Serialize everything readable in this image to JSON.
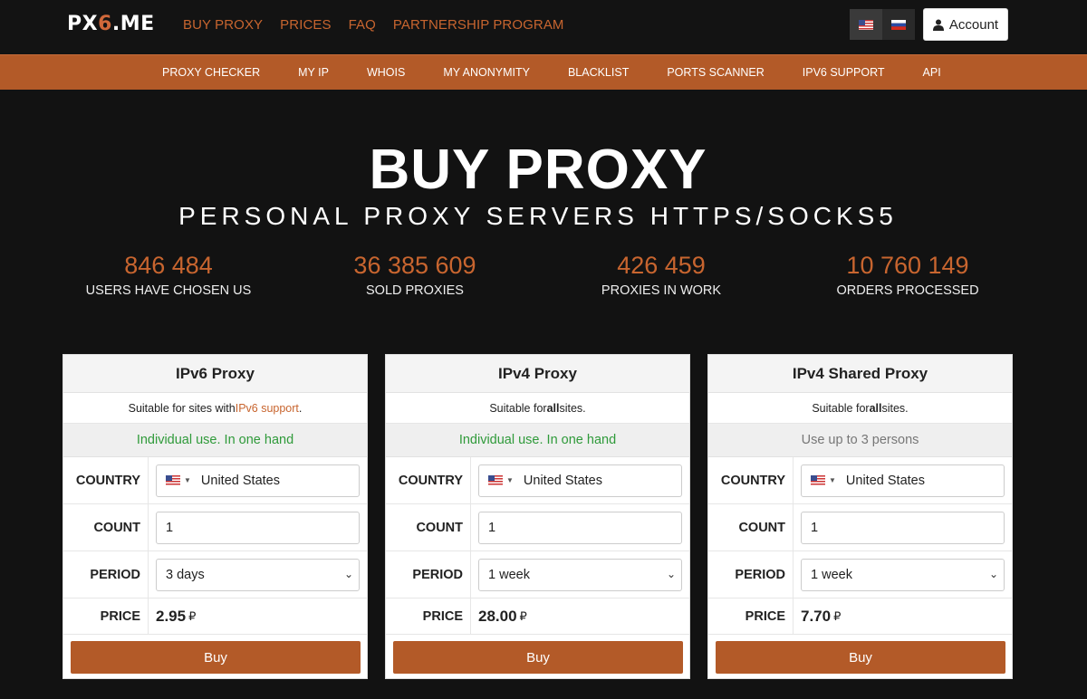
{
  "logo": {
    "prefix": "PX",
    "six": "6",
    "suffix": ".ME"
  },
  "main_nav": [
    "BUY PROXY",
    "PRICES",
    "FAQ",
    "PARTNERSHIP PROGRAM"
  ],
  "account_label": "Account",
  "sub_nav": [
    "PROXY CHECKER",
    "MY IP",
    "WHOIS",
    "MY ANONYMITY",
    "BLACKLIST",
    "PORTS SCANNER",
    "IPV6 SUPPORT",
    "API"
  ],
  "hero": {
    "title": "BUY PROXY",
    "subtitle": "PERSONAL PROXY SERVERS HTTPS/SOCKS5"
  },
  "stats": [
    {
      "num": "846 484",
      "label": "USERS HAVE CHOSEN US"
    },
    {
      "num": "36 385 609",
      "label": "SOLD PROXIES"
    },
    {
      "num": "426 459",
      "label": "PROXIES IN WORK"
    },
    {
      "num": "10 760 149",
      "label": "ORDERS PROCESSED"
    }
  ],
  "labels": {
    "country": "COUNTRY",
    "count": "COUNT",
    "period": "PERIOD",
    "price": "PRICE",
    "currency": "₽",
    "buy": "Buy"
  },
  "cards": [
    {
      "title": "IPv6 Proxy",
      "suit_pre": "Suitable for sites with ",
      "suit_hl": "IPv6 support",
      "suit_post": ".",
      "use": "Individual use. In one hand",
      "country": "United States",
      "count": "1",
      "period": "3 days",
      "price": "2.95"
    },
    {
      "title": "IPv4 Proxy",
      "suit_pre": "Suitable for ",
      "suit_hl": "all",
      "suit_post": " sites.",
      "use": "Individual use. In one hand",
      "country": "United States",
      "count": "1",
      "period": "1 week",
      "price": "28.00"
    },
    {
      "title": "IPv4 Shared Proxy",
      "suit_pre": "Suitable for ",
      "suit_hl": "all",
      "suit_post": " sites.",
      "use": "Use up to 3 persons",
      "country": "United States",
      "count": "1",
      "period": "1 week",
      "price": "7.70"
    }
  ],
  "colors": {
    "accent": "#b35a28",
    "link": "#c8652f",
    "green": "#2f9a3a"
  }
}
